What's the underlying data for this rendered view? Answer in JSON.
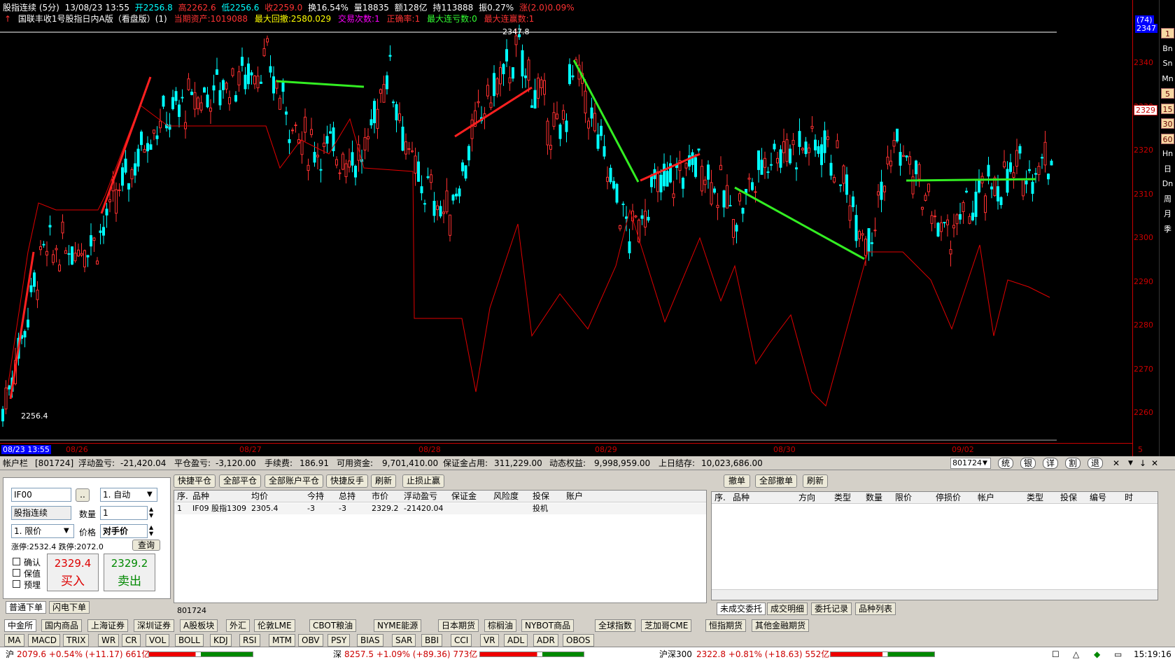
{
  "chart_header": {
    "title": "股指连续 (5分)",
    "date": "13/08/23 13:55",
    "open": "开2256.8",
    "high": "高2262.6",
    "low": "低2256.6",
    "close": "收2259.0",
    "turnover": "换16.54%",
    "volume": "量18835",
    "amount": "额128亿",
    "hold": "持113888",
    "amplitude": "振0.27%",
    "change": "涨(2.0)0.09%"
  },
  "strategy_line": {
    "name": "国联丰收1号股指日内A版（看盘版）(1)",
    "assets": "当期资产:1019088",
    "max_drawdown": "最大回撤:2580.029",
    "trade_count": "交易次数:1",
    "win_rate": "正确率:1",
    "max_win_streak": "最大连亏数:0",
    "max_loss_streak": "最大连赢数:1"
  },
  "price_axis": [
    "2340",
    "2330",
    "2320",
    "2310",
    "2300",
    "2290",
    "2280",
    "2270",
    "2260"
  ],
  "axis_top": "(74)",
  "axis_top2": "2347",
  "current_price": "2329",
  "peak_label": "2347.8",
  "low_label": "2256.4",
  "x_labels": [
    "08/23 13:55",
    "08/26",
    "08/27",
    "08/28",
    "08/29",
    "08/30",
    "09/02"
  ],
  "xaxis_unit": "5分",
  "side_tools": [
    "1",
    "Bn",
    "Sn",
    "Mn",
    "5",
    "15",
    "30",
    "60",
    "Hn",
    "日",
    "Dn",
    "周",
    "月",
    "季"
  ],
  "account": {
    "label": "帐户栏",
    "acct": "[801724]",
    "float_pl_lbl": "浮动盈亏:",
    "float_pl": "-21,420.04",
    "close_pl_lbl": "平仓盈亏:",
    "close_pl": "-3,120.00",
    "fee_lbl": "手续费:",
    "fee": "186.91",
    "avail_lbl": "可用资金:",
    "avail": "9,701,410.00",
    "margin_lbl": "保证金占用:",
    "margin": "311,229.00",
    "equity_lbl": "动态权益:",
    "equity": "9,998,959.00",
    "prev_lbl": "上日结存:",
    "prev": "10,023,686.00",
    "select": "801724",
    "btns": [
      "统",
      "银",
      "详",
      "割",
      "退"
    ]
  },
  "order": {
    "code": "IF00",
    "name": "股指连续",
    "auto": "1. 自动",
    "qty_lbl": "数量",
    "qty": "1",
    "type": "1. 限价",
    "price_lbl": "价格",
    "price": "对手价",
    "limit": "涨停:2532.4 跌停:2072.0",
    "query": "查询",
    "confirm": "确认",
    "hedge": "保值",
    "prebury": "预埋",
    "buy_price": "2329.4",
    "buy": "买入",
    "sell_price": "2329.2",
    "sell": "卖出",
    "tabs": [
      "普通下单",
      "闪电下单"
    ]
  },
  "pos": {
    "btns": [
      "快捷平仓",
      "全部平仓",
      "全部账户平仓",
      "快捷反手",
      "刷新",
      "止损止赢"
    ],
    "headers": [
      "序.",
      "品种",
      "均价",
      "今持",
      "总持",
      "市价",
      "浮动盈亏",
      "保证金",
      "风险度",
      "投保",
      "账户"
    ],
    "rows": [
      [
        "1",
        "IF09 股指1309",
        "2305.4",
        "-3",
        "-3",
        "2329.2",
        "-21420.04",
        "",
        "",
        "投机",
        ""
      ]
    ],
    "footer": "801724"
  },
  "orders": {
    "btns": [
      "撤单",
      "全部撤单",
      "刷新"
    ],
    "headers": [
      "序.",
      "品种",
      "方向",
      "类型",
      "数量",
      "限价",
      "停损价",
      "帐户",
      "类型",
      "投保",
      "编号",
      "时"
    ],
    "tabs": [
      "未成交委托",
      "成交明细",
      "委托记录",
      "品种列表"
    ]
  },
  "market_tabs": [
    "中金所",
    "国内商品",
    "上海证券",
    "深圳证券",
    "A股板块",
    "外汇",
    "伦敦LME",
    "CBOT粮油",
    "NYME能源",
    "日本期货",
    "棕榈油",
    "NYBOT商品",
    "全球指数",
    "芝加哥CME",
    "恒指期货",
    "其他金融期货"
  ],
  "indicators": [
    "MA",
    "MACD",
    "TRIX",
    "WR",
    "CR",
    "VOL",
    "BOLL",
    "KDJ",
    "RSI",
    "MTM",
    "OBV",
    "PSY",
    "BIAS",
    "SAR",
    "BBI",
    "CCI",
    "VR",
    "ADL",
    "ADR",
    "OBOS"
  ],
  "status": {
    "sh_lbl": "沪",
    "sh": "2079.6 +0.54% (+11.17) 661亿",
    "sz_lbl": "深",
    "sz": "8257.5 +1.09% (+89.36) 773亿",
    "hs_lbl": "沪深300",
    "hs": "2322.8 +0.81% (+18.63) 552亿",
    "time": "15:19:16"
  },
  "colors": {
    "up": "#ff3030",
    "down": "#00ffff",
    "eq_line": "#e00000",
    "long_trade": "#ff2020",
    "short_trade": "#33ee22",
    "axis": "#c00000"
  }
}
